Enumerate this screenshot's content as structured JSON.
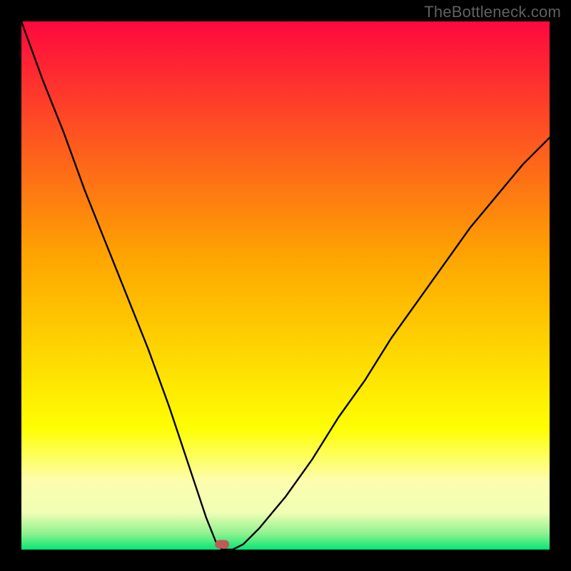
{
  "watermark": "TheBottleneck.com",
  "chart_data": {
    "type": "line",
    "title": "",
    "xlabel": "",
    "ylabel": "",
    "xlim": [
      0,
      100
    ],
    "ylim": [
      0,
      100
    ],
    "optimal_x": 38,
    "marker": {
      "x": 38,
      "y": 1
    },
    "background_gradient": [
      {
        "pos": 0.0,
        "color": "#fe083e"
      },
      {
        "pos": 0.45,
        "color": "#fea601"
      },
      {
        "pos": 0.77,
        "color": "#fefe02"
      },
      {
        "pos": 0.87,
        "color": "#fdfdae"
      },
      {
        "pos": 0.93,
        "color": "#f0feb4"
      },
      {
        "pos": 0.97,
        "color": "#8df28e"
      },
      {
        "pos": 1.0,
        "color": "#06e575"
      }
    ],
    "curve": {
      "x": [
        0,
        4,
        8,
        12,
        16,
        20,
        24,
        28,
        32,
        35,
        37,
        38,
        40,
        42,
        45,
        50,
        55,
        60,
        65,
        70,
        75,
        80,
        85,
        90,
        95,
        100
      ],
      "y": [
        100,
        89,
        79,
        68,
        58,
        48,
        38,
        27,
        15,
        6,
        1,
        0,
        0,
        1,
        4,
        10,
        17,
        25,
        32,
        40,
        47,
        54,
        61,
        67,
        73,
        78
      ]
    }
  }
}
